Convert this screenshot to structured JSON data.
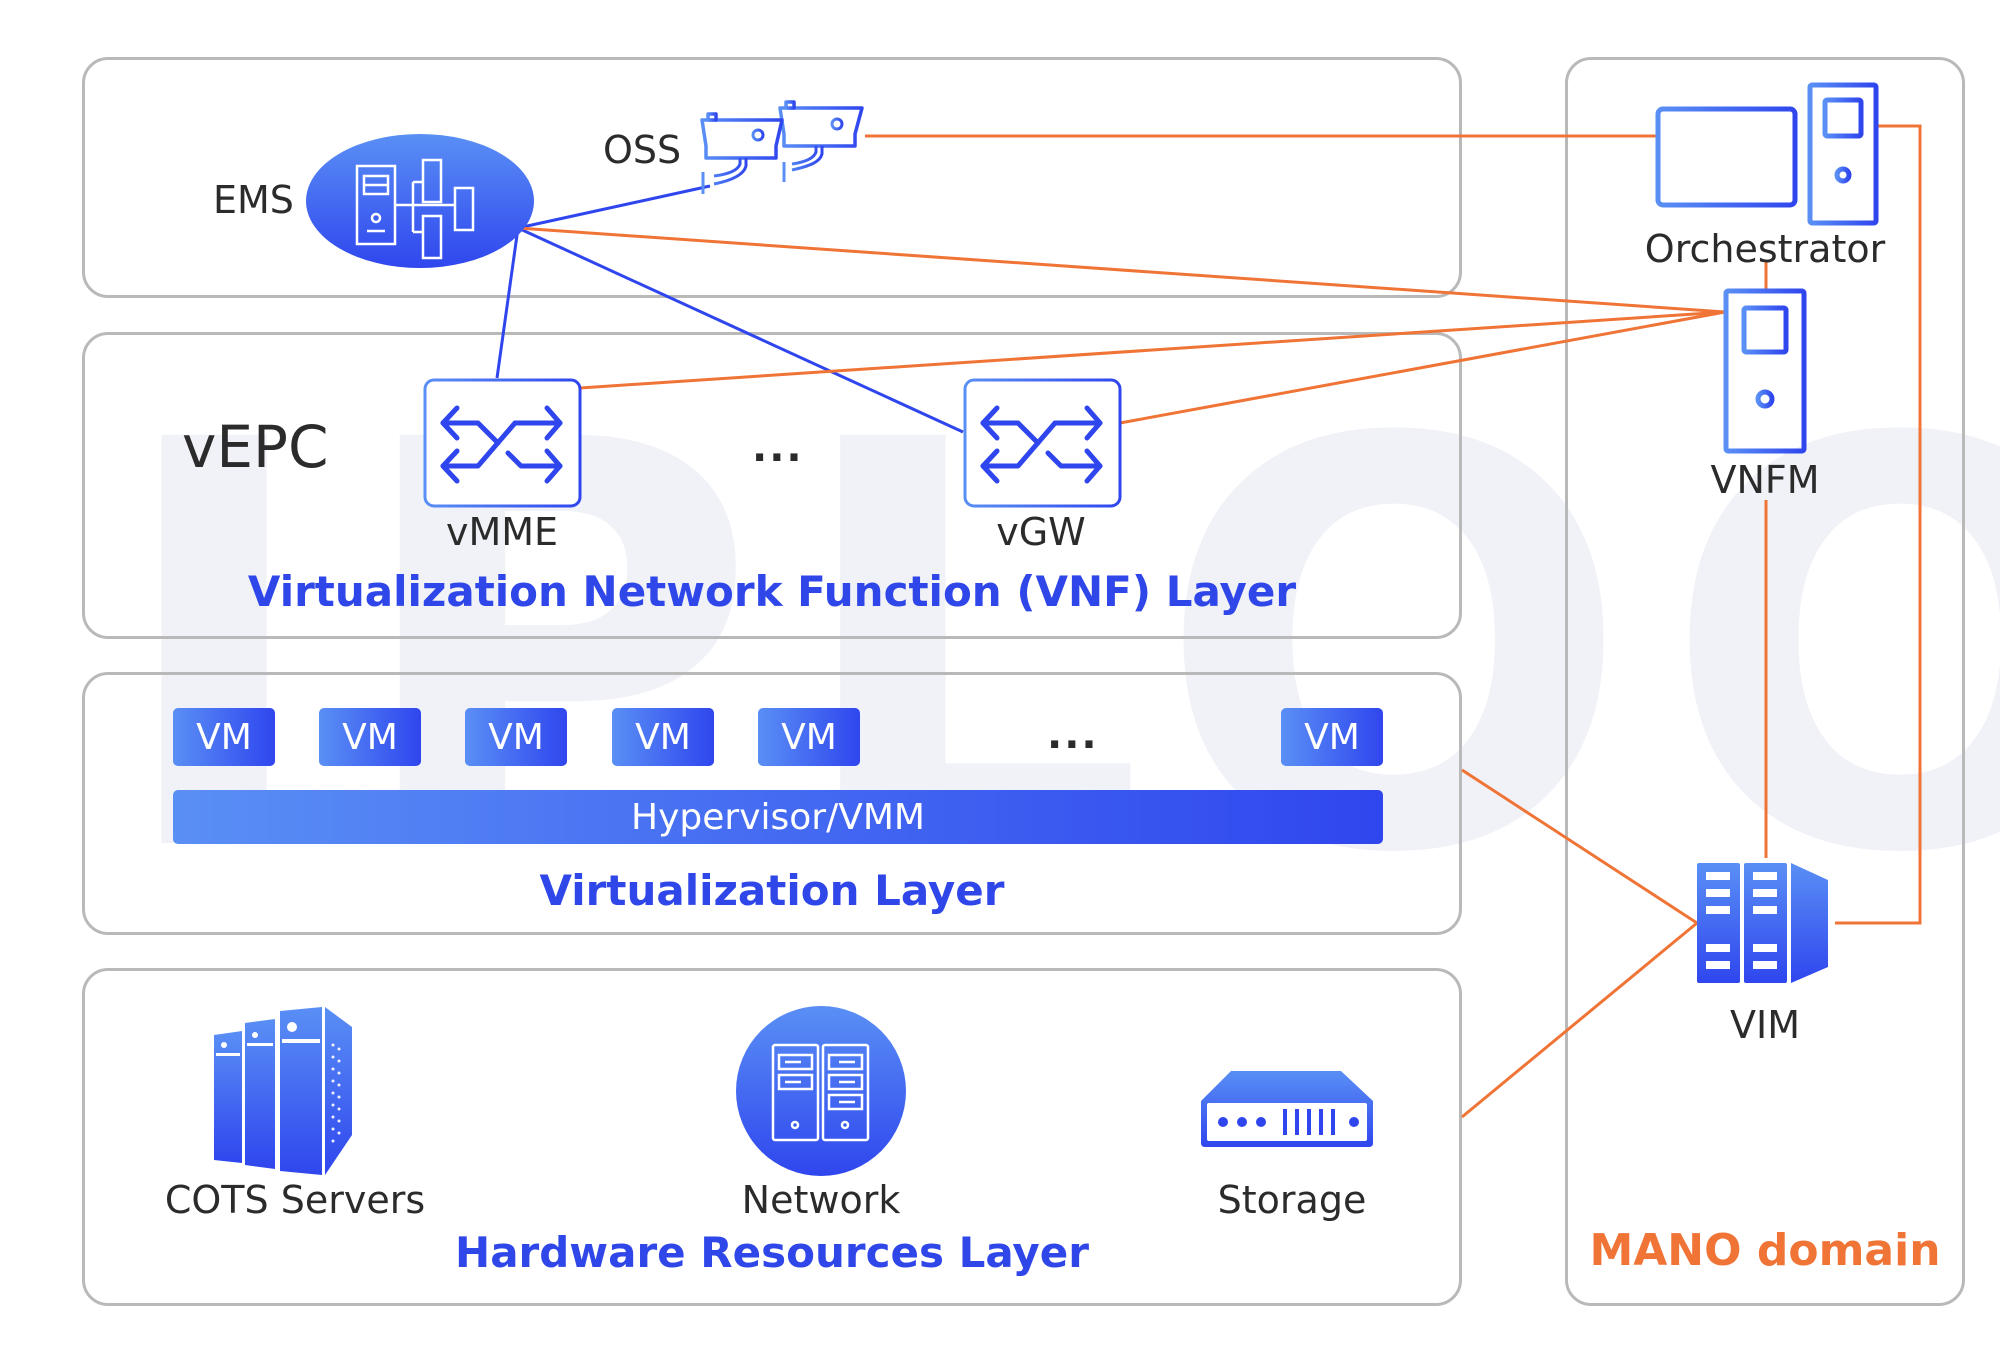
{
  "watermark": "IPLOOK",
  "colors": {
    "accent_blue": "#2f46ee",
    "accent_blue_light": "#5a8ff5",
    "mano_orange": "#f07436",
    "box_border": "#b9b9b9",
    "text_dark": "#2b2b2b"
  },
  "management": {
    "ems_label": "EMS",
    "oss_label": "OSS"
  },
  "vnf_layer": {
    "group_label": "vEPC",
    "title": "Virtualization Network Function (VNF) Layer",
    "functions": [
      {
        "label": "vMME",
        "icon": "switch-arrows-icon"
      },
      {
        "label": "vGW",
        "icon": "switch-arrows-icon"
      }
    ],
    "ellipsis": "..."
  },
  "virtualization_layer": {
    "title": "Virtualization Layer",
    "vms": [
      "VM",
      "VM",
      "VM",
      "VM",
      "VM",
      "VM"
    ],
    "ellipsis": "...",
    "hypervisor_label": "Hypervisor/VMM"
  },
  "hardware_layer": {
    "title": "Hardware Resources Layer",
    "resources": [
      {
        "label": "COTS Servers",
        "icon": "server-rack-icon"
      },
      {
        "label": "Network",
        "icon": "network-server-icon"
      },
      {
        "label": "Storage",
        "icon": "storage-device-icon"
      }
    ]
  },
  "mano": {
    "title": "MANO domain",
    "orchestrator_label": "Orchestrator",
    "vnfm_label": "VNFM",
    "vim_label": "VIM"
  }
}
